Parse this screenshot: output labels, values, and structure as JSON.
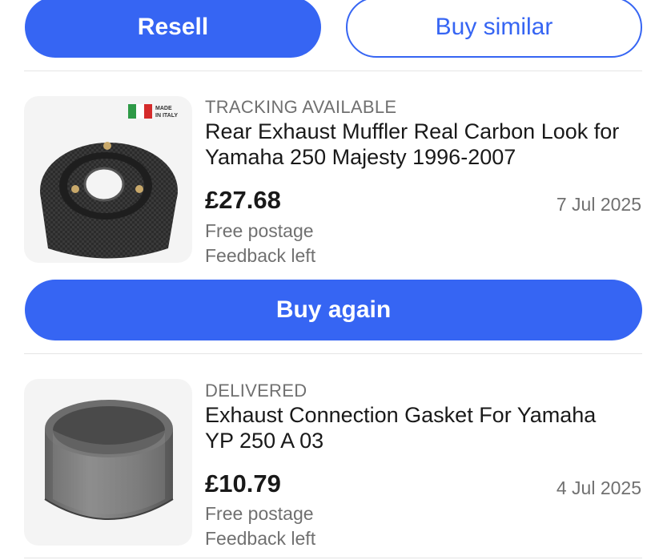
{
  "actions": {
    "resell_label": "Resell",
    "buy_similar_label": "Buy similar"
  },
  "orders": [
    {
      "status": "TRACKING AVAILABLE",
      "title_line1": "Rear Exhaust Muffler Real Carbon Look for",
      "title_line2": "Yamaha 250 Majesty 1996-2007",
      "price": "£27.68",
      "date": "7 Jul 2025",
      "postage": "Free postage",
      "feedback": "Feedback left",
      "badge_line1": "MADE",
      "badge_line2": "IN ITALY",
      "buy_again_label": "Buy again"
    },
    {
      "status": "DELIVERED",
      "title_line1": "Exhaust Connection Gasket For Yamaha",
      "title_line2": "YP 250 A 03",
      "price": "£10.79",
      "date": "4 Jul 2025",
      "postage": "Free postage",
      "feedback": "Feedback left"
    }
  ],
  "colors": {
    "accent": "#3665f3",
    "secondary_text": "#707070",
    "primary_text": "#191919"
  }
}
